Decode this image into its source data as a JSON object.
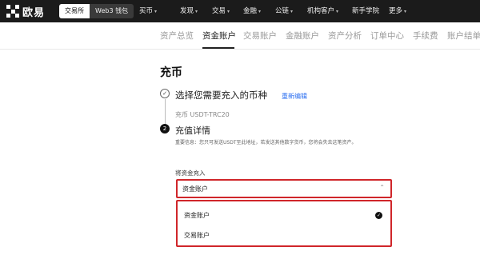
{
  "brand": {
    "name": "欧易"
  },
  "top_segment": {
    "exchange": "交易所",
    "web3": "Web3 钱包"
  },
  "top_nav": [
    {
      "label": "买币",
      "chevron": "▾"
    },
    {
      "label": "发现",
      "chevron": "▾"
    },
    {
      "label": "交易",
      "chevron": "▾"
    },
    {
      "label": "金融",
      "chevron": "▾"
    },
    {
      "label": "公链",
      "chevron": "▾"
    },
    {
      "label": "机构客户",
      "chevron": "▾"
    },
    {
      "label": "新手学院",
      "chevron": ""
    },
    {
      "label": "更多",
      "chevron": "▾"
    }
  ],
  "sub_nav": [
    {
      "label": "资产总览",
      "active": false
    },
    {
      "label": "资金账户",
      "active": true
    },
    {
      "label": "交易账户",
      "active": false
    },
    {
      "label": "金融账户",
      "active": false
    },
    {
      "label": "资产分析",
      "active": false
    },
    {
      "label": "订单中心",
      "active": false
    },
    {
      "label": "手续费",
      "active": false
    },
    {
      "label": "账户结单",
      "active": false
    }
  ],
  "page": {
    "title": "充币",
    "step1": {
      "icon": "check-icon",
      "glyph": "✓",
      "title": "选择您需要充入的币种",
      "reselect": "重新编辑",
      "selected": "充币 USDT-TRC20"
    },
    "step2": {
      "number": "2",
      "title": "充值详情",
      "notice": "重要信息：您只可发送USDT至此地址，若发送其他数字货币，您将会失去这笔资产。"
    },
    "deposit_to": {
      "label": "将资金充入",
      "value": "资金账户",
      "chevron": "⌃",
      "options": [
        {
          "label": "资金账户",
          "selected": true
        },
        {
          "label": "交易账户",
          "selected": false
        }
      ],
      "check_glyph": "✓"
    }
  },
  "colors": {
    "highlight": "#d0262a",
    "link": "#2a6ef0",
    "nav_bg": "#1b1b1b"
  }
}
